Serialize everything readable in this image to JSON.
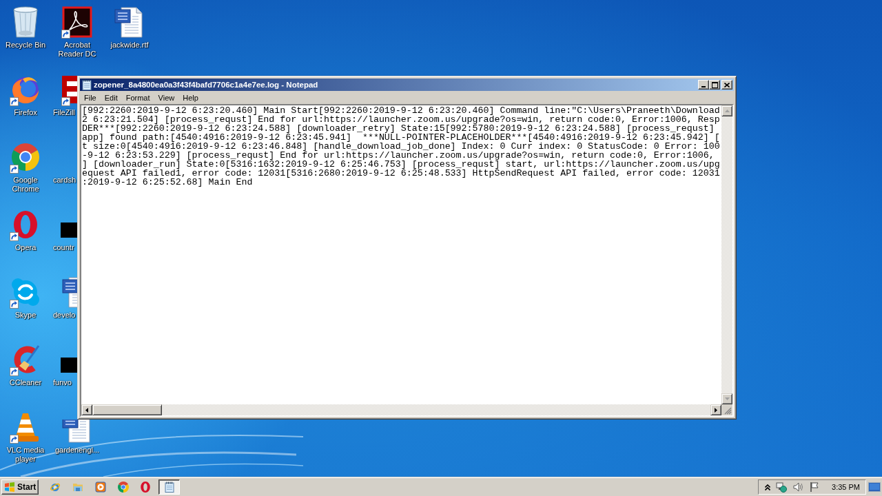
{
  "desktop": {
    "icons": [
      {
        "label": "Recycle Bin",
        "kind": "recycle-bin",
        "shortcut": false
      },
      {
        "label": "Firefox",
        "kind": "firefox",
        "shortcut": true
      },
      {
        "label": "Google Chrome",
        "kind": "chrome",
        "shortcut": true
      },
      {
        "label": "Opera",
        "kind": "opera",
        "shortcut": true
      },
      {
        "label": "Skype",
        "kind": "skype",
        "shortcut": true
      },
      {
        "label": "CCleaner",
        "kind": "ccleaner",
        "shortcut": true
      },
      {
        "label": "VLC media player",
        "kind": "vlc",
        "shortcut": true
      },
      {
        "label": "Acrobat Reader DC",
        "kind": "acrobat",
        "shortcut": true
      },
      {
        "label": "FileZill",
        "kind": "filezilla",
        "shortcut": true
      },
      {
        "label": "cardsh",
        "shortcut": false
      },
      {
        "label": "countr",
        "kind": "dark-thumbnail",
        "shortcut": false
      },
      {
        "label": "develo",
        "kind": "word-doc",
        "shortcut": false
      },
      {
        "label": "funvo",
        "kind": "dark-thumbnail",
        "shortcut": false
      },
      {
        "label": "gardenengl...",
        "kind": "word-doc",
        "shortcut": false
      },
      {
        "label": "jackwide.rtf",
        "kind": "word-doc",
        "shortcut": false
      }
    ]
  },
  "window": {
    "title": "zopener_8a4800ea0a3f43f4bafd7706c1a4e7ee.log - Notepad",
    "menu": [
      "File",
      "Edit",
      "Format",
      "View",
      "Help"
    ],
    "lines": [
      "[992:2260:2019-9-12 6:23:20.460] Main Start[992:2260:2019-9-12 6:23:20.460] Command line:\"C:\\Users\\Praneeth\\Download",
      "2 6:23:21.504] [process_requst] End for url:https://launcher.zoom.us/upgrade?os=win, return code:0, Error:1006, Resp",
      "DER***[992:2260:2019-9-12 6:23:24.588] [downloader_retry] State:15[992:5780:2019-9-12 6:23:24.588] [process_requst]",
      "app] found path:[4540:4916:2019-9-12 6:23:45.941]  ***NULL-POINTER-PLACEHOLDER***[4540:4916:2019-9-12 6:23:45.942] [",
      "t size:0[4540:4916:2019-9-12 6:23:46.848] [handle_download_job_done] Index: 0 Curr index: 0 StatusCode: 0 Error: 100",
      "-9-12 6:23:53.229] [process_requst] End for url:https://launcher.zoom.us/upgrade?os=win, return code:0, Error:1006,",
      "] [downloader_run] State:0[5316:1632:2019-9-12 6:25:46.753] [process_requst] start, url:https://launcher.zoom.us/upg",
      "equest API failed1, error code: 12031[5316:2680:2019-9-12 6:25:48.533] HttpSendRequest API failed, error code: 12031",
      ":2019-9-12 6:25:52.68] Main End"
    ]
  },
  "taskbar": {
    "start": "Start",
    "quick_launch": [
      {
        "kind": "ie"
      },
      {
        "kind": "explorer"
      },
      {
        "kind": "media-player"
      },
      {
        "kind": "chrome"
      },
      {
        "kind": "opera"
      }
    ],
    "tasks": [
      {
        "kind": "notepad",
        "selected": true
      }
    ],
    "tray": [
      {
        "kind": "chevron"
      },
      {
        "kind": "network"
      },
      {
        "kind": "volume"
      },
      {
        "kind": "flag"
      }
    ],
    "clock": "3:35 PM"
  }
}
